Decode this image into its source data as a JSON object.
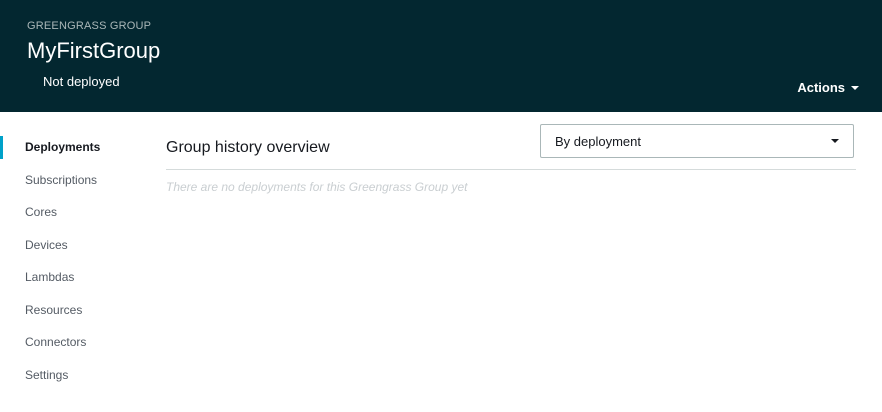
{
  "header": {
    "eyebrow": "GREENGRASS GROUP",
    "title": "MyFirstGroup",
    "status": "Not deployed",
    "actions_label": "Actions"
  },
  "sidebar": {
    "items": [
      {
        "label": "Deployments",
        "active": true
      },
      {
        "label": "Subscriptions"
      },
      {
        "label": "Cores"
      },
      {
        "label": "Devices"
      },
      {
        "label": "Lambdas"
      },
      {
        "label": "Resources"
      },
      {
        "label": "Connectors"
      },
      {
        "label": "Settings"
      }
    ]
  },
  "main": {
    "section_title": "Group history overview",
    "view_select": {
      "selected": "By deployment"
    },
    "empty_message": "There are no deployments for this Greengrass Group yet"
  },
  "colors": {
    "header_bg": "#032730",
    "accent": "#00a1c9"
  }
}
